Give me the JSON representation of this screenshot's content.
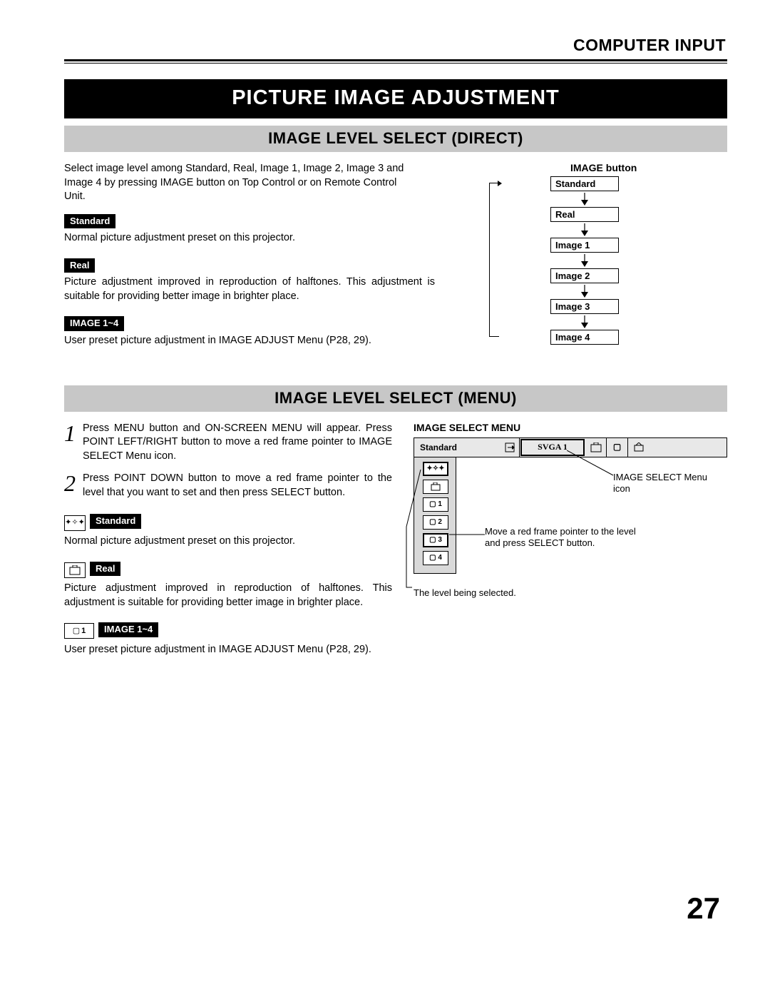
{
  "header": "COMPUTER INPUT",
  "title": "PICTURE IMAGE ADJUSTMENT",
  "direct": {
    "heading": "IMAGE LEVEL SELECT (DIRECT)",
    "intro": "Select image level among Standard, Real, Image 1, Image 2, Image 3 and Image 4 by pressing IMAGE button on Top Control or on Remote Control Unit.",
    "items": [
      {
        "tag": "Standard",
        "desc": "Normal picture adjustment preset on this projector."
      },
      {
        "tag": "Real",
        "desc": "Picture adjustment improved in reproduction of halftones.  This adjustment is suitable for providing better image in brighter place."
      },
      {
        "tag": "IMAGE 1~4",
        "desc": "User preset picture adjustment in IMAGE ADJUST Menu (P28, 29)."
      }
    ],
    "button_label": "IMAGE button",
    "flow": [
      "Standard",
      "Real",
      "Image 1",
      "Image 2",
      "Image 3",
      "Image 4"
    ]
  },
  "menu": {
    "heading": "IMAGE LEVEL SELECT (MENU)",
    "steps": [
      "Press MENU button and ON-SCREEN MENU will appear.  Press POINT LEFT/RIGHT button to move a red frame pointer to IMAGE SELECT Menu icon.",
      "Press POINT DOWN button to move a red frame pointer to the level that you want to set and then press SELECT button."
    ],
    "items": [
      {
        "tag": "Standard",
        "desc": "Normal picture adjustment preset on this projector.",
        "icon": "✦✧✦"
      },
      {
        "tag": "Real",
        "desc": "Picture adjustment improved in reproduction of halftones.  This adjustment is suitable for providing better image in brighter place.",
        "icon": "▢"
      },
      {
        "tag": "IMAGE 1~4",
        "desc": "User preset picture adjustment in IMAGE ADJUST Menu (P28, 29).",
        "icon": "▢ 1"
      }
    ],
    "osd": {
      "title": "IMAGE SELECT MENU",
      "top_label": "Standard",
      "mode": "SVGA 1",
      "callout1": "IMAGE SELECT Menu icon",
      "callout2": "Move a red frame pointer to the level and press SELECT button.",
      "callout3": "The level being selected."
    }
  },
  "page": "27"
}
